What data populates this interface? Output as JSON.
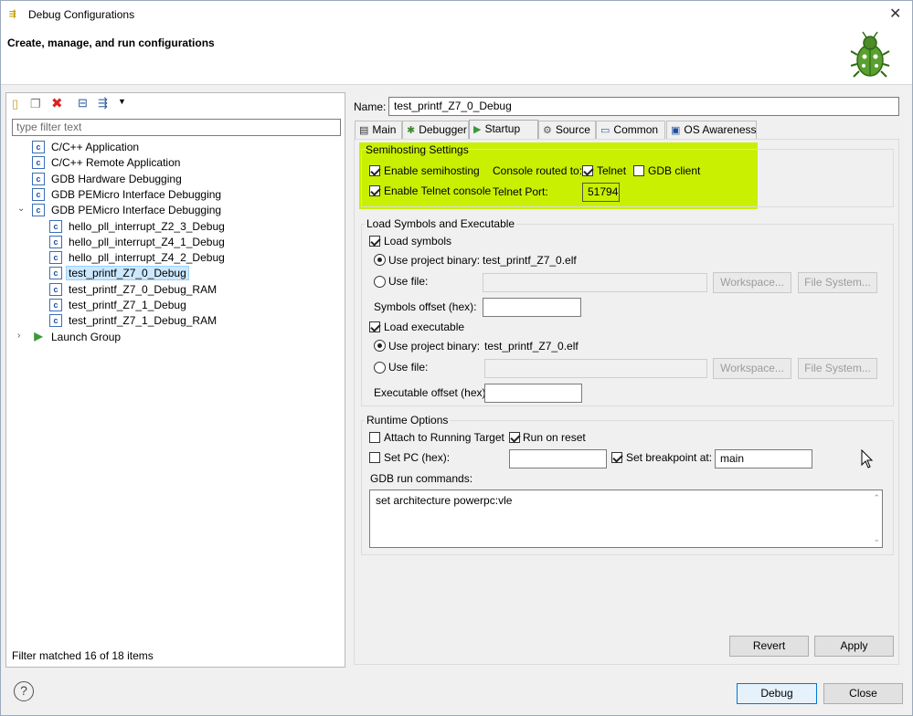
{
  "window": {
    "title": "Debug Configurations",
    "header": "Create, manage, and run configurations"
  },
  "filter": {
    "placeholder": "type filter text",
    "status": "Filter matched 16 of 18 items"
  },
  "tree": [
    {
      "label": "C/C++ Application",
      "indent": 0
    },
    {
      "label": "C/C++ Remote Application",
      "indent": 0
    },
    {
      "label": "GDB Hardware Debugging",
      "indent": 0
    },
    {
      "label": "GDB PEMicro Interface Debugging",
      "indent": 0
    },
    {
      "label": "GDB PEMicro Interface Debugging",
      "indent": 0,
      "expanded": true
    },
    {
      "label": "hello_pll_interrupt_Z2_3_Debug",
      "indent": 1
    },
    {
      "label": "hello_pll_interrupt_Z4_1_Debug",
      "indent": 1
    },
    {
      "label": "hello_pll_interrupt_Z4_2_Debug",
      "indent": 1
    },
    {
      "label": "test_printf_Z7_0_Debug",
      "indent": 1,
      "selected": true
    },
    {
      "label": "test_printf_Z7_0_Debug_RAM",
      "indent": 1
    },
    {
      "label": "test_printf_Z7_1_Debug",
      "indent": 1
    },
    {
      "label": "test_printf_Z7_1_Debug_RAM",
      "indent": 1
    },
    {
      "label": "Launch Group",
      "indent": 0,
      "collapsed": true
    }
  ],
  "config": {
    "name_label": "Name:",
    "name_value": "test_printf_Z7_0_Debug"
  },
  "tabs": [
    "Main",
    "Debugger",
    "Startup",
    "Source",
    "Common",
    "OS Awareness"
  ],
  "semihosting": {
    "title": "Semihosting Settings",
    "enable_semihosting": "Enable semihosting",
    "console_routed": "Console routed to:",
    "telnet": "Telnet",
    "gdb_client": "GDB client",
    "enable_telnet": "Enable Telnet console",
    "telnet_port_label": "Telnet Port:",
    "telnet_port": "51794"
  },
  "load": {
    "title": "Load Symbols and Executable",
    "load_symbols": "Load symbols",
    "use_project_binary": "Use project binary:",
    "symbols_binary": "test_printf_Z7_0.elf",
    "use_file": "Use file:",
    "workspace": "Workspace...",
    "file_system": "File System...",
    "symbols_offset": "Symbols offset (hex):",
    "load_executable": "Load executable",
    "exec_binary": "test_printf_Z7_0.elf",
    "exec_offset": "Executable offset (hex):"
  },
  "runtime": {
    "title": "Runtime Options",
    "attach": "Attach to Running Target",
    "run_on_reset": "Run on reset",
    "set_pc": "Set PC (hex):",
    "set_breakpoint": "Set breakpoint at:",
    "breakpoint_value": "main",
    "gdb_run_commands": "GDB run commands:",
    "commands": "set architecture powerpc:vle"
  },
  "buttons": {
    "revert": "Revert",
    "apply": "Apply",
    "debug": "Debug",
    "close": "Close"
  },
  "colors": {
    "highlight": "#c8f000",
    "selection": "#cce8ff"
  }
}
